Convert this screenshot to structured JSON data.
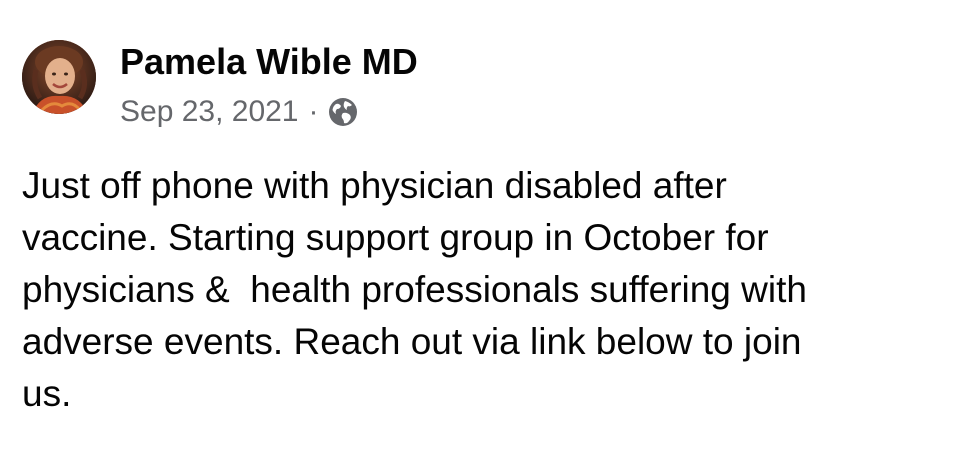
{
  "post": {
    "author_name": "Pamela Wible MD",
    "date": "Sep 23, 2021",
    "separator": "·",
    "audience_icon": "globe-icon",
    "body_text": "Just off phone with physician disabled after\nvaccine. Starting support group in October for\nphysicians &  health professionals suffering with\nadverse events. Reach out via link below to join\nus."
  }
}
